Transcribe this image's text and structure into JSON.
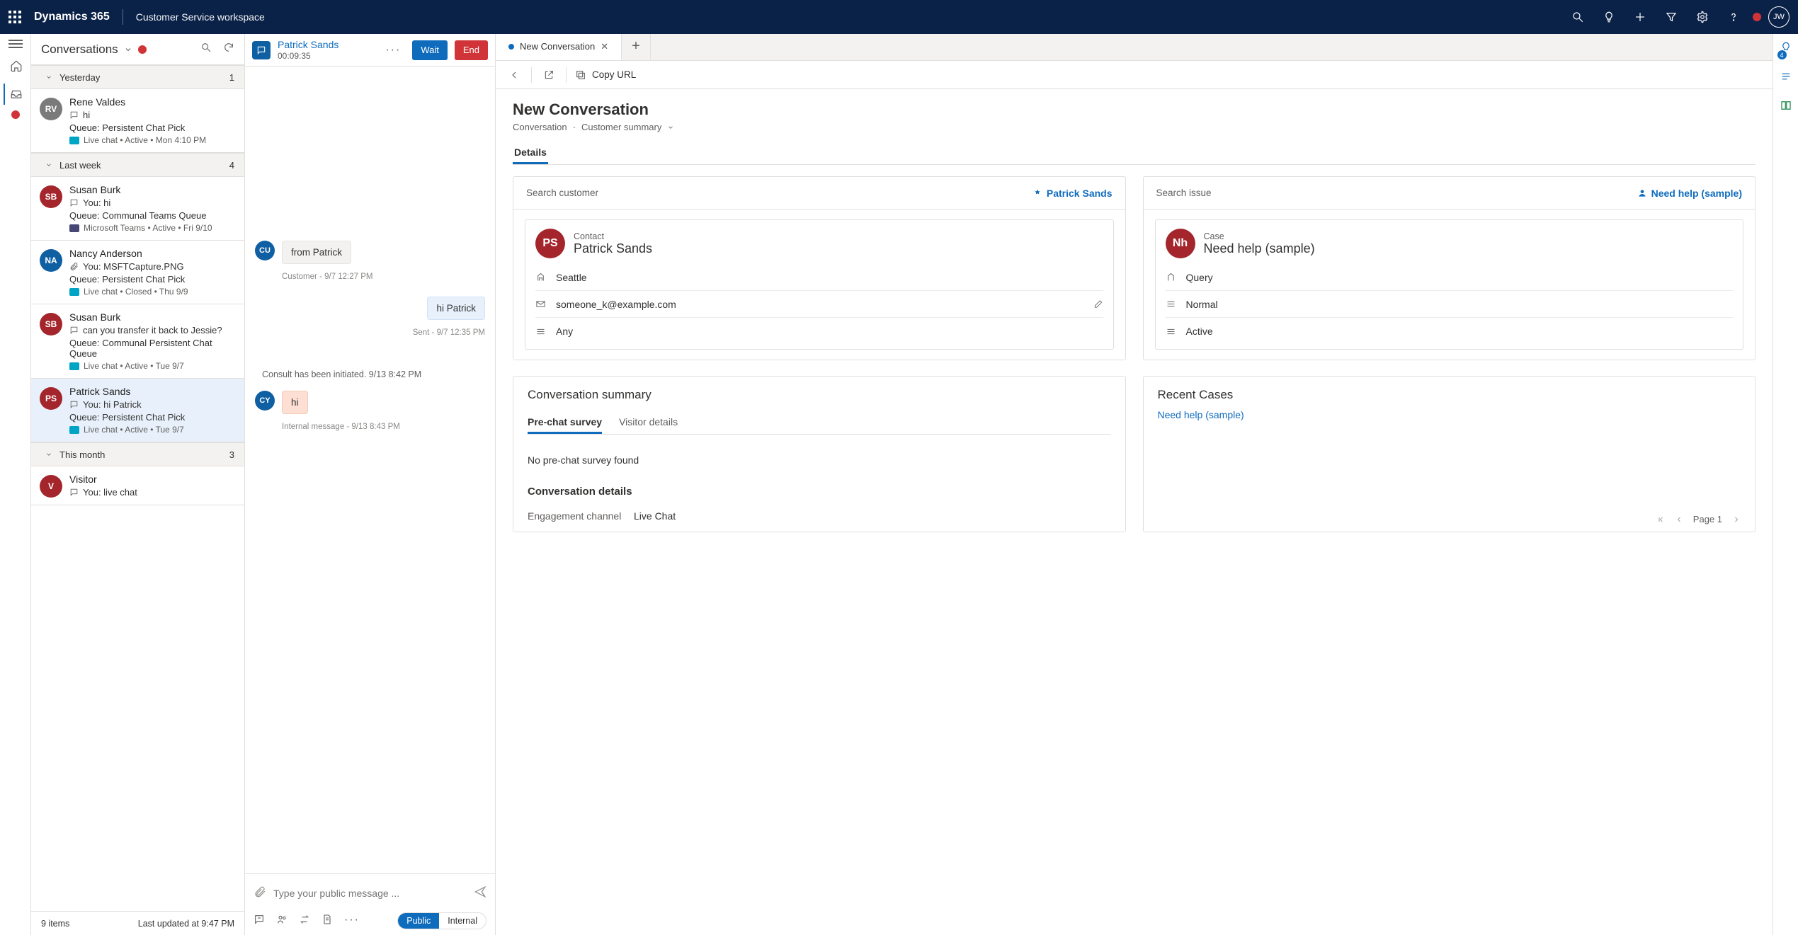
{
  "top": {
    "brand": "Dynamics 365",
    "workspace": "Customer Service workspace",
    "avatar_initials": "JW"
  },
  "list": {
    "title": "Conversations",
    "footer_count": "9 items",
    "footer_updated": "Last updated at 9:47 PM",
    "groups": [
      {
        "label": "Yesterday",
        "count": "1"
      },
      {
        "label": "Last week",
        "count": "4"
      },
      {
        "label": "This month",
        "count": "3"
      }
    ],
    "items": {
      "rv": {
        "initials": "RV",
        "name": "Rene Valdes",
        "preview": "hi",
        "queue": "Queue: Persistent Chat Pick",
        "status": "Live chat  •  Active  •  Mon 4:10 PM"
      },
      "sb1": {
        "initials": "SB",
        "name": "Susan Burk",
        "preview": "You: hi",
        "queue": "Queue: Communal Teams Queue",
        "status": "Microsoft Teams  •  Active  •  Fri 9/10"
      },
      "na": {
        "initials": "NA",
        "name": "Nancy Anderson",
        "preview": "You: MSFTCapture.PNG",
        "queue": "Queue: Persistent Chat Pick",
        "status": "Live chat  •  Closed  •  Thu 9/9"
      },
      "sb2": {
        "initials": "SB",
        "name": "Susan Burk",
        "preview": "can you transfer it back to Jessie?",
        "queue": "Queue: Communal Persistent Chat Queue",
        "status": "Live chat  •  Active  •  Tue 9/7"
      },
      "ps": {
        "initials": "PS",
        "name": "Patrick Sands",
        "preview": "You: hi Patrick",
        "queue": "Queue: Persistent Chat Pick",
        "status": "Live chat  •  Active  •  Tue 9/7"
      },
      "v": {
        "initials": "V",
        "name": "Visitor",
        "preview": "You: live chat"
      }
    }
  },
  "chat": {
    "title": "Patrick Sands",
    "timer": "00:09:35",
    "wait": "Wait",
    "end": "End",
    "m1": "from Patrick",
    "m1_meta": "Customer - 9/7 12:27 PM",
    "m2": "hi Patrick",
    "m2_meta": "Sent - 9/7 12:35 PM",
    "sys": "Consult has been initiated. 9/13 8:42 PM",
    "m3": "hi",
    "m3_meta": "Internal message - 9/13 8:43 PM",
    "placeholder": "Type your public message ...",
    "public": "Public",
    "internal": "Internal",
    "cu": "CU",
    "cy": "CY"
  },
  "right": {
    "tab_label": "New Conversation",
    "copy": "Copy URL",
    "title": "New Conversation",
    "bc1": "Conversation",
    "bc2": "Customer summary",
    "details_tab": "Details",
    "customer": {
      "lookup_label": "Search customer",
      "lookup_value": "Patrick Sands",
      "entity": "Contact",
      "name": "Patrick Sands",
      "initials": "PS",
      "city": "Seattle",
      "email": "someone_k@example.com",
      "pref": "Any"
    },
    "case": {
      "lookup_label": "Search issue",
      "lookup_value": "Need help (sample)",
      "entity": "Case",
      "name": "Need help (sample)",
      "initials": "Nh",
      "type": "Query",
      "priority": "Normal",
      "status": "Active"
    },
    "summary": {
      "title": "Conversation summary",
      "tab1": "Pre-chat survey",
      "tab2": "Visitor details",
      "empty": "No pre-chat survey found",
      "details_title": "Conversation details",
      "engagement_k": "Engagement channel",
      "engagement_v": "Live Chat"
    },
    "recent": {
      "title": "Recent Cases",
      "link": "Need help (sample)",
      "page": "Page 1"
    }
  },
  "rail": {
    "badge": "4"
  }
}
